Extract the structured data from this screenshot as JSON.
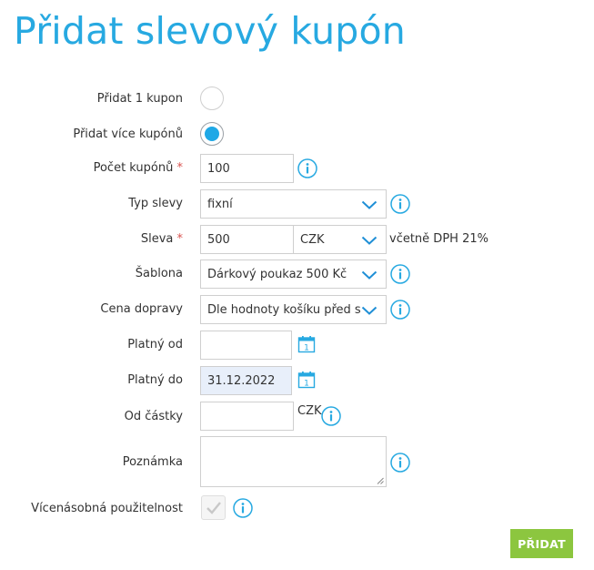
{
  "page": {
    "title": "Přidat slevový kupón"
  },
  "form": {
    "single": {
      "label": "Přidat 1 kupon",
      "checked": false
    },
    "multiple": {
      "label": "Přidat více kupónů",
      "checked": true
    },
    "count": {
      "label": "Počet kupónů",
      "required_mark": "*",
      "value": "100"
    },
    "discount_type": {
      "label": "Typ slevy",
      "value": "fixní"
    },
    "discount": {
      "label": "Sleva",
      "required_mark": "*",
      "value": "500",
      "currency": "CZK",
      "vat_note": "včetně DPH 21%"
    },
    "template": {
      "label": "Šablona",
      "value": "Dárkový poukaz 500 Kč"
    },
    "shipping": {
      "label": "Cena dopravy",
      "value": "Dle hodnoty košíku před s"
    },
    "valid_from": {
      "label": "Platný od",
      "value": ""
    },
    "valid_to": {
      "label": "Platný do",
      "value": "31.12.2022"
    },
    "min_amount": {
      "label": "Od částky",
      "value": "",
      "currency": "CZK"
    },
    "note": {
      "label": "Poznámka",
      "value": ""
    },
    "reusable": {
      "label": "Vícenásobná použitelnost",
      "checked": true
    }
  },
  "actions": {
    "submit_label": "PŘIDAT"
  },
  "colors": {
    "accent": "#27a9e1",
    "radio_fill": "#1fa8e6",
    "submit": "#8cc63f",
    "required": "#d9534f"
  },
  "icons": {
    "info": "info-icon",
    "calendar": "calendar-icon",
    "chevron": "chevron-down-icon",
    "check": "check-icon"
  }
}
